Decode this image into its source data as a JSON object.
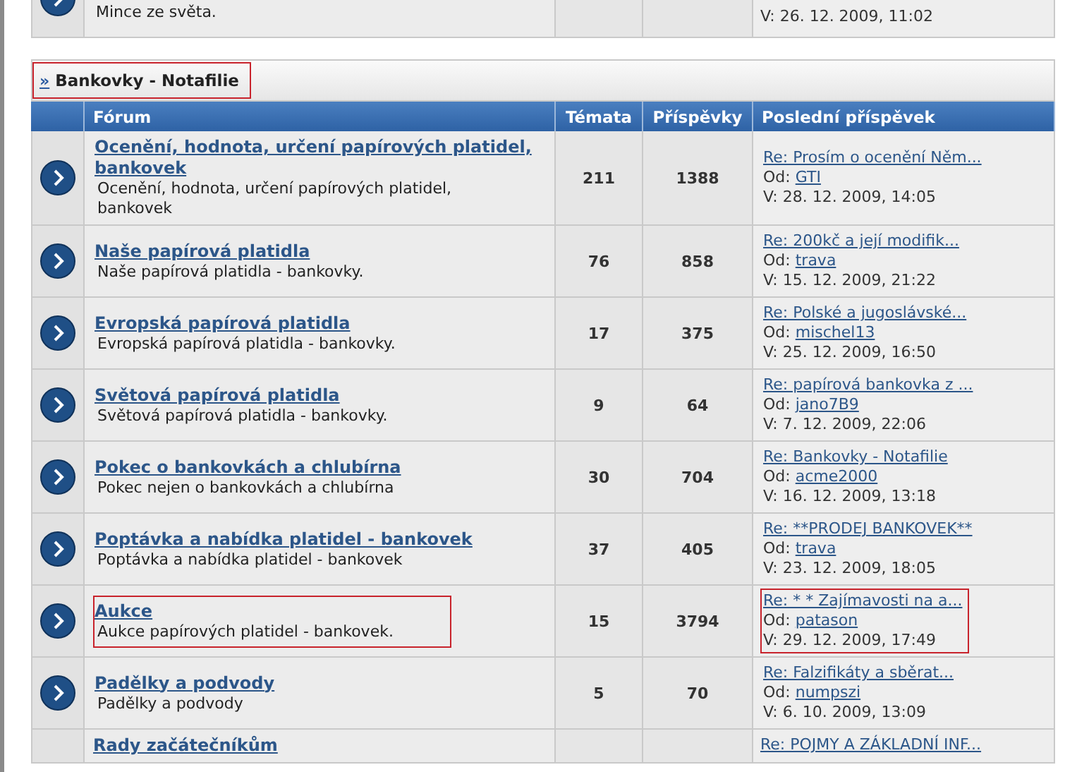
{
  "previous_row": {
    "description": "Mince ze světa.",
    "last_post_date": "V: 26. 12. 2009, 11:02"
  },
  "category": {
    "marker": "»",
    "title": "Bankovky - Notafilie",
    "highlighted": true
  },
  "columns": [
    "Fórum",
    "Témata",
    "Příspěvky",
    "Poslední příspěvek"
  ],
  "rows": [
    {
      "title": "Ocenění, hodnota, určení papírových platidel, bankovek",
      "description": "Ocenění, hodnota, určení papírových platidel, bankovek",
      "topics": "211",
      "posts": "1388",
      "last_post": {
        "subject": "Re: Prosím o ocenění Něm...",
        "by_label": "Od:",
        "author": "GTI",
        "date": "V: 28. 12. 2009, 14:05"
      },
      "highlighted": false
    },
    {
      "title": "Naše papírová platidla",
      "description": "Naše papírová platidla - bankovky.",
      "topics": "76",
      "posts": "858",
      "last_post": {
        "subject": "Re: 200kč a její modifik...",
        "by_label": "Od:",
        "author": "trava",
        "date": "V: 15. 12. 2009, 21:22"
      },
      "highlighted": false
    },
    {
      "title": "Evropská papírová platidla",
      "description": "Evropská papírová platidla - bankovky.",
      "topics": "17",
      "posts": "375",
      "last_post": {
        "subject": "Re: Polské a jugoslávské...",
        "by_label": "Od:",
        "author": "mischel13",
        "date": "V: 25. 12. 2009, 16:50"
      },
      "highlighted": false
    },
    {
      "title": "Světová papírová platidla",
      "description": "Světová papírová platidla - bankovky.",
      "topics": "9",
      "posts": "64",
      "last_post": {
        "subject": "Re: papírová bankovka z ...",
        "by_label": "Od:",
        "author": "jano7B9",
        "date": "V: 7. 12. 2009, 22:06"
      },
      "highlighted": false
    },
    {
      "title": "Pokec o bankovkách a chlubírna",
      "description": "Pokec nejen o bankovkách a chlubírna",
      "topics": "30",
      "posts": "704",
      "last_post": {
        "subject": "Re: Bankovky - Notafilie",
        "by_label": "Od:",
        "author": "acme2000",
        "date": "V: 16. 12. 2009, 13:18"
      },
      "highlighted": false
    },
    {
      "title": "Poptávka a nabídka platidel - bankovek",
      "description": "Poptávka a nabídka platidel - bankovek",
      "topics": "37",
      "posts": "405",
      "last_post": {
        "subject": "Re: **PRODEJ BANKOVEK**",
        "by_label": "Od:",
        "author": "trava",
        "date": "V: 23. 12. 2009, 18:05"
      },
      "highlighted": false
    },
    {
      "title": "Aukce",
      "description": "Aukce papírových platidel - bankovek.",
      "topics": "15",
      "posts": "3794",
      "last_post": {
        "subject": "Re: * * Zajímavosti na a...",
        "by_label": "Od:",
        "author": "patason",
        "date": "V: 29. 12. 2009, 17:49"
      },
      "highlighted": true
    },
    {
      "title": "Padělky a podvody",
      "description": "Padělky a podvody",
      "topics": "5",
      "posts": "70",
      "last_post": {
        "subject": "Re: Falzifikáty a sběrat...",
        "by_label": "Od:",
        "author": "numpszi",
        "date": "V: 6. 10. 2009, 13:09"
      },
      "highlighted": false
    }
  ],
  "partial_row": {
    "title": "Rady začátečníkům",
    "last_post_subject": "Re: POJMY A ZÁKLADNÍ INF..."
  }
}
